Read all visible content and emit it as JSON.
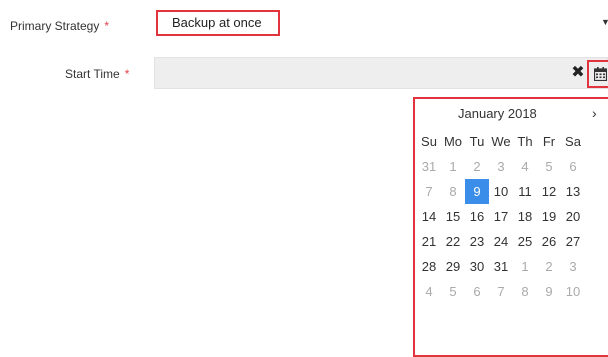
{
  "form": {
    "strategy": {
      "label": "Primary Strategy",
      "required_mark": "*",
      "selected_value": "Backup at once",
      "caret_icon": "caret-down-icon"
    },
    "start_time": {
      "label": "Start Time",
      "required_mark": "*",
      "value": "",
      "clear_icon": "✖",
      "calendar_icon": "calendar-icon"
    }
  },
  "datepicker": {
    "month_title": "January 2018",
    "next_label": "›",
    "weekdays": [
      "Su",
      "Mo",
      "Tu",
      "We",
      "Th",
      "Fr",
      "Sa"
    ],
    "weeks": [
      [
        {
          "d": "31",
          "t": "old"
        },
        {
          "d": "1",
          "t": "old"
        },
        {
          "d": "2",
          "t": "old"
        },
        {
          "d": "3",
          "t": "old"
        },
        {
          "d": "4",
          "t": "old"
        },
        {
          "d": "5",
          "t": "old"
        },
        {
          "d": "6",
          "t": "old"
        }
      ],
      [
        {
          "d": "7",
          "t": "old"
        },
        {
          "d": "8",
          "t": "old"
        },
        {
          "d": "9",
          "t": "active"
        },
        {
          "d": "10",
          "t": "day"
        },
        {
          "d": "11",
          "t": "day"
        },
        {
          "d": "12",
          "t": "day"
        },
        {
          "d": "13",
          "t": "day"
        }
      ],
      [
        {
          "d": "14",
          "t": "day"
        },
        {
          "d": "15",
          "t": "day"
        },
        {
          "d": "16",
          "t": "day"
        },
        {
          "d": "17",
          "t": "day"
        },
        {
          "d": "18",
          "t": "day"
        },
        {
          "d": "19",
          "t": "day"
        },
        {
          "d": "20",
          "t": "day"
        }
      ],
      [
        {
          "d": "21",
          "t": "day"
        },
        {
          "d": "22",
          "t": "day"
        },
        {
          "d": "23",
          "t": "day"
        },
        {
          "d": "24",
          "t": "day"
        },
        {
          "d": "25",
          "t": "day"
        },
        {
          "d": "26",
          "t": "day"
        },
        {
          "d": "27",
          "t": "day"
        }
      ],
      [
        {
          "d": "28",
          "t": "day"
        },
        {
          "d": "29",
          "t": "day"
        },
        {
          "d": "30",
          "t": "day"
        },
        {
          "d": "31",
          "t": "day"
        },
        {
          "d": "1",
          "t": "new"
        },
        {
          "d": "2",
          "t": "new"
        },
        {
          "d": "3",
          "t": "new"
        }
      ],
      [
        {
          "d": "4",
          "t": "new"
        },
        {
          "d": "5",
          "t": "new"
        },
        {
          "d": "6",
          "t": "new"
        },
        {
          "d": "7",
          "t": "new"
        },
        {
          "d": "8",
          "t": "new"
        },
        {
          "d": "9",
          "t": "new"
        },
        {
          "d": "10",
          "t": "new"
        }
      ]
    ],
    "selected_day": "9"
  },
  "colors": {
    "required": "#e2424a",
    "highlight_border": "#e2343d",
    "selected_day_bg": "#3a8eea"
  }
}
